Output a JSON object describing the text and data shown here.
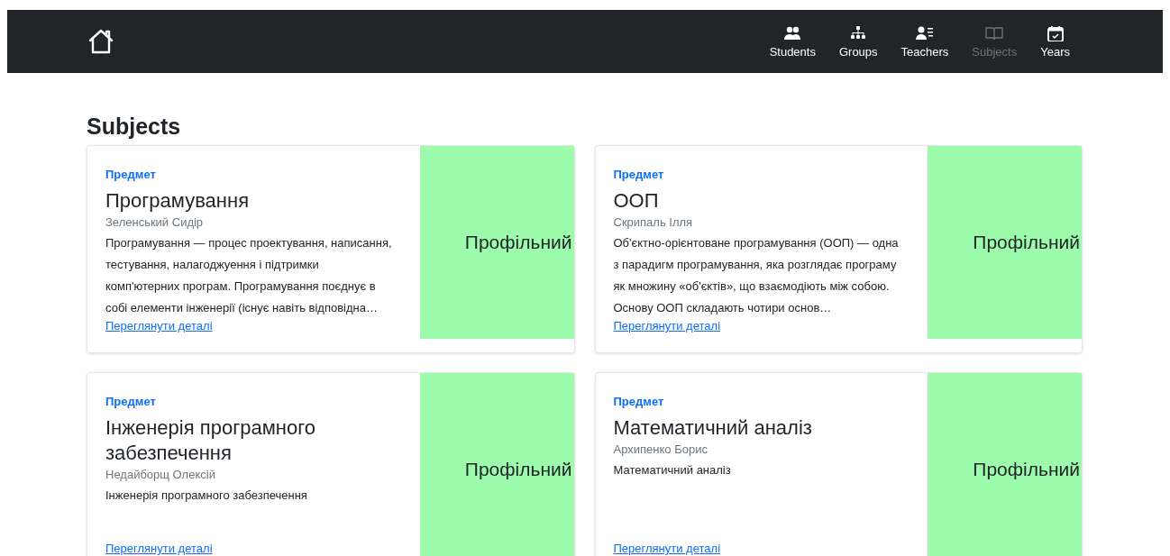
{
  "navbar": {
    "nav_items": [
      {
        "label": "Students",
        "selected": false
      },
      {
        "label": "Groups",
        "selected": false
      },
      {
        "label": "Teachers",
        "selected": false
      },
      {
        "label": "Subjects",
        "selected": true
      },
      {
        "label": "Years",
        "selected": false
      }
    ]
  },
  "page_title": "Subjects",
  "cards": [
    {
      "label": "Предмет",
      "title": "Програмування",
      "teacher": "Зеленський Сидір",
      "description": "Програмування — процес проектування, написання, тестування, налагоджуення і підтримки комп'ютерних програм. Програмування поєднує в собі елементи інженерії (існує навіть відповідна…",
      "link": "Переглянути деталі",
      "type": "Профільний",
      "color": "#9cfcac"
    },
    {
      "label": "Предмет",
      "title": "ООП",
      "teacher": "Скрипаль Ілля",
      "description": "Об'єктно-орієнтоване програмування (ООП) — одна з парадигм програмування, яка розглядає програму як множину «об'єктів», що взаємодіють між собою. Основу ООП складають чотири основ…",
      "link": "Переглянути деталі",
      "type": "Профільний",
      "color": "#9cfcac"
    },
    {
      "label": "Предмет",
      "title": "Інженерія програмного забезпечення",
      "teacher": "Недайборщ Олексій",
      "description": "Інженерія програмного забезпечення",
      "link": "Переглянути деталі",
      "type": "Профільний",
      "color": "#9cfcac"
    },
    {
      "label": "Предмет",
      "title": "Математичний аналіз",
      "teacher": "Архипенко Борис",
      "description": "Математичний аналіз",
      "link": "Переглянути деталі",
      "type": "Профільний",
      "color": "#9cfcac"
    }
  ]
}
